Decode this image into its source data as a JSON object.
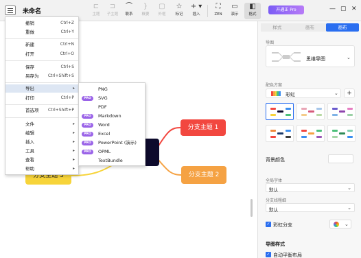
{
  "window": {
    "title": "未命名",
    "pro_badge": "开通正 Pro"
  },
  "toolbar": [
    {
      "label": "主题",
      "icon": "subtopic-icon",
      "enabled": false
    },
    {
      "label": "子主题",
      "icon": "child-topic-icon",
      "enabled": false
    },
    {
      "label": "联系",
      "icon": "relationship-icon",
      "enabled": true
    },
    {
      "label": "概要",
      "icon": "summary-icon",
      "enabled": false
    },
    {
      "label": "外框",
      "icon": "boundary-icon",
      "enabled": false
    },
    {
      "label": "标记",
      "icon": "marker-icon",
      "enabled": true
    },
    {
      "label": "插入",
      "icon": "insert-icon",
      "enabled": true
    },
    {
      "label": "ZEN",
      "icon": "zen-icon",
      "enabled": true
    },
    {
      "label": "演示",
      "icon": "pitch-icon",
      "enabled": true
    },
    {
      "label": "格式",
      "icon": "format-icon",
      "enabled": true
    }
  ],
  "menu": {
    "items": [
      {
        "label": "撤销",
        "shortcut": "Ctrl+Z"
      },
      {
        "label": "重做",
        "shortcut": "Ctrl+Y"
      },
      {
        "label": "新建",
        "shortcut": "Ctrl+N"
      },
      {
        "label": "打开",
        "shortcut": "Ctrl+O"
      },
      {
        "label": "保存",
        "shortcut": "Ctrl+S"
      },
      {
        "label": "另存为",
        "shortcut": "Ctrl+Shift+S"
      },
      {
        "label": "导出",
        "shortcut": ""
      },
      {
        "label": "打印",
        "shortcut": "Ctrl+P"
      },
      {
        "label": "首选项",
        "shortcut": "Ctrl+Shift+P"
      },
      {
        "label": "文件",
        "shortcut": ""
      },
      {
        "label": "编辑",
        "shortcut": ""
      },
      {
        "label": "插入",
        "shortcut": ""
      },
      {
        "label": "工具",
        "shortcut": ""
      },
      {
        "label": "查看",
        "shortcut": ""
      },
      {
        "label": "帮助",
        "shortcut": ""
      }
    ]
  },
  "export_menu": {
    "items": [
      {
        "label": "PNG",
        "pro": false
      },
      {
        "label": "SVG",
        "pro": true
      },
      {
        "label": "PDF",
        "pro": false
      },
      {
        "label": "Markdown",
        "pro": true
      },
      {
        "label": "Word",
        "pro": true
      },
      {
        "label": "Excel",
        "pro": true
      },
      {
        "label": "PowerPoint (演示)",
        "pro": true
      },
      {
        "label": "OPML",
        "pro": true
      },
      {
        "label": "TextBundle",
        "pro": false
      }
    ],
    "pro_label": "PRO"
  },
  "canvas": {
    "center_topic": "题",
    "topics": [
      "分支主题 1",
      "分支主题 2",
      "分支主题 3"
    ]
  },
  "panel": {
    "tabs": [
      "样式",
      "画布",
      "画布"
    ],
    "structure_label": "导图",
    "structure_value": "思维导图",
    "palette_label": "配色方案",
    "palette_value": "彩虹",
    "bg_label": "背景颜色",
    "font_label": "全局字体",
    "font_value": "默认",
    "line_label": "分支线粗细",
    "line_value": "默认",
    "rainbow_label": "彩虹分支",
    "map_style_title": "导图样式",
    "auto_balance_label": "自动平衡布局"
  },
  "colors": {
    "accent": "#2a6ef0",
    "topic1": "#f2473f",
    "topic2": "#f5a243",
    "topic3": "#f7d43a",
    "center": "#0d0a2c"
  }
}
